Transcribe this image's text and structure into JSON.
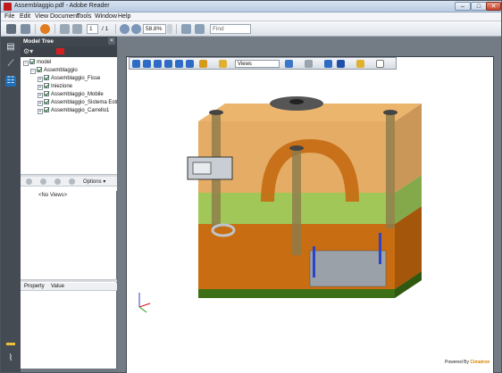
{
  "window": {
    "title": "Assemblaggio.pdf - Adobe Reader",
    "minimize_label": "–",
    "maximize_label": "□",
    "close_label": "✕"
  },
  "menu": [
    "File",
    "Edit",
    "View",
    "Document",
    "Tools",
    "Window",
    "Help"
  ],
  "toolbar": {
    "page_current": "1",
    "page_total": "/ 1",
    "zoom_value": "58.8%",
    "find_placeholder": "Find"
  },
  "colors": {
    "accent": "#1f6fb8",
    "brand_red": "#c21a1a",
    "rail_bg": "#444b53",
    "panel_head_bg": "#3f464e"
  },
  "rail_icons": [
    "pages-icon",
    "bookmarks-icon",
    "model-tree-icon",
    "comment-icon",
    "attachment-icon"
  ],
  "model_tree": {
    "title": "Model Tree",
    "close_label": "×",
    "items": [
      {
        "label": "model",
        "level": 0
      },
      {
        "label": "Assemblaggio",
        "level": 1
      },
      {
        "label": "Assemblaggio_Fisse",
        "level": 2
      },
      {
        "label": "Iniezione",
        "level": 2
      },
      {
        "label": "Assemblaggio_Mobile",
        "level": 2
      },
      {
        "label": "Assemblaggio_Sistema Estr",
        "level": 2
      },
      {
        "label": "Assemblaggio_Carrello1",
        "level": 2
      }
    ]
  },
  "views_panel": {
    "options_label": "Options ▾",
    "empty_label": "<No Views>"
  },
  "properties": {
    "column_property": "Property",
    "column_value": "Value"
  },
  "toolbar3d": {
    "views_select": "Views"
  },
  "footer": {
    "powered_by": "Powered By",
    "brand": "Cimatron"
  }
}
